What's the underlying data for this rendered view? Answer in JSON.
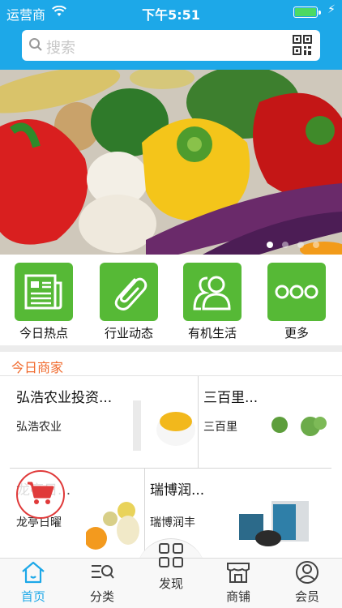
{
  "status_bar": {
    "carrier": "运营商",
    "time": "下午5:51"
  },
  "search": {
    "placeholder": "搜索"
  },
  "banner": {
    "dots": 4,
    "active_dot": 0
  },
  "categories": [
    {
      "label": "今日热点",
      "icon": "newspaper-icon"
    },
    {
      "label": "行业动态",
      "icon": "paperclip-icon"
    },
    {
      "label": "有机生活",
      "icon": "people-icon"
    },
    {
      "label": "更多",
      "icon": "more-icon"
    }
  ],
  "section": {
    "title": "今日商家"
  },
  "merchants": [
    {
      "name": "弘浩农业投资...",
      "sub": "弘浩农业"
    },
    {
      "name": "三百里...",
      "sub": "三百里"
    },
    {
      "name": "龙亭日...",
      "sub": "龙亭日曜"
    },
    {
      "name": "瑞博润...",
      "sub": "瑞博润丰"
    }
  ],
  "tabbar": [
    {
      "label": "首页",
      "icon": "home-icon"
    },
    {
      "label": "分类",
      "icon": "category-search-icon"
    },
    {
      "label": "发现",
      "icon": "grid-icon"
    },
    {
      "label": "商铺",
      "icon": "store-icon"
    },
    {
      "label": "会员",
      "icon": "user-icon"
    }
  ],
  "colors": {
    "primary": "#1da8e8",
    "green": "#56b936",
    "accent": "#f06a2d"
  }
}
